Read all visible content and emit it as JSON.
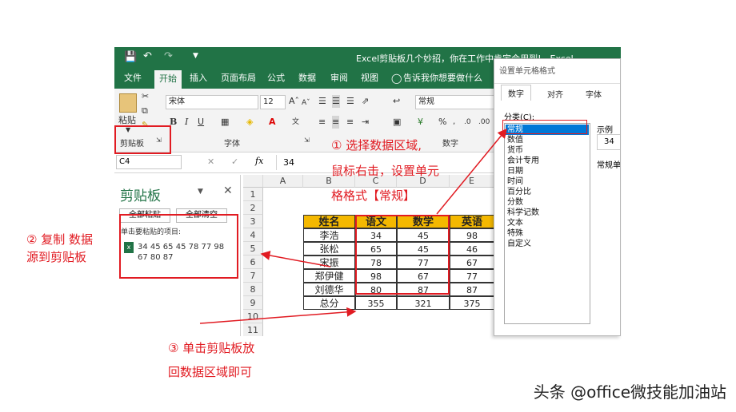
{
  "window": {
    "title": "Excel剪贴板几个妙招，你在工作中肯定会用到! - Excel"
  },
  "ribbon": {
    "tabs": [
      "文件",
      "开始",
      "插入",
      "页面布局",
      "公式",
      "数据",
      "审阅",
      "视图"
    ],
    "tell_me": "告诉我你想要做什么",
    "font_name": "宋体",
    "font_size": "12",
    "number_format": "常规",
    "paste_label": "粘贴",
    "groups": {
      "clipboard": "剪贴板",
      "font": "字体",
      "number": "数字"
    }
  },
  "formula_bar": {
    "name_box": "C4",
    "fx": "fx",
    "value": "34"
  },
  "clipboard_pane": {
    "title": "剪贴板",
    "paste_all": "全部粘贴",
    "clear_all": "全部清空",
    "hint": "单击要粘贴的项目:",
    "item": "34 45 65 45 78 77 98 67 80 87"
  },
  "sheet": {
    "columns": [
      "A",
      "B",
      "C",
      "D",
      "E"
    ],
    "rows": [
      "1",
      "2",
      "3",
      "4",
      "5",
      "6",
      "7",
      "8",
      "9",
      "10",
      "11"
    ],
    "headers": [
      "姓名",
      "语文",
      "数学",
      "英语"
    ],
    "data": [
      [
        "李浩",
        "34",
        "45",
        "98"
      ],
      [
        "张松",
        "65",
        "45",
        "46"
      ],
      [
        "宋振",
        "78",
        "77",
        "67"
      ],
      [
        "郑伊健",
        "98",
        "67",
        "77"
      ],
      [
        "刘德华",
        "80",
        "87",
        "87"
      ],
      [
        "总分",
        "355",
        "321",
        "375"
      ]
    ]
  },
  "dialog": {
    "title": "设置单元格格式",
    "tabs": [
      "数字",
      "对齐",
      "字体"
    ],
    "category_label": "分类(C):",
    "categories": [
      "常规",
      "数值",
      "货币",
      "会计专用",
      "日期",
      "时间",
      "百分比",
      "分数",
      "科学记数",
      "文本",
      "特殊",
      "自定义"
    ],
    "selected_category": "常规",
    "sample_label": "示例",
    "sample_value": "34",
    "desc": "常规单"
  },
  "annotations": {
    "step1_line1": "① 选择数据区域,",
    "step1_line2": "鼠标右击，设置单元",
    "step1_line3": "格格式【常规】",
    "step2_line1": "② 复制 数据",
    "step2_line2": "源到剪贴板",
    "step3_line1": "③ 单击剪贴板放",
    "step3_line2": "回数据区域即可"
  },
  "watermark": "头条 @office微技能加油站",
  "colors": {
    "excel_green": "#217346",
    "header_fill": "#f4b800",
    "annotation_red": "#e11b22",
    "selection_blue": "#0078d7"
  }
}
